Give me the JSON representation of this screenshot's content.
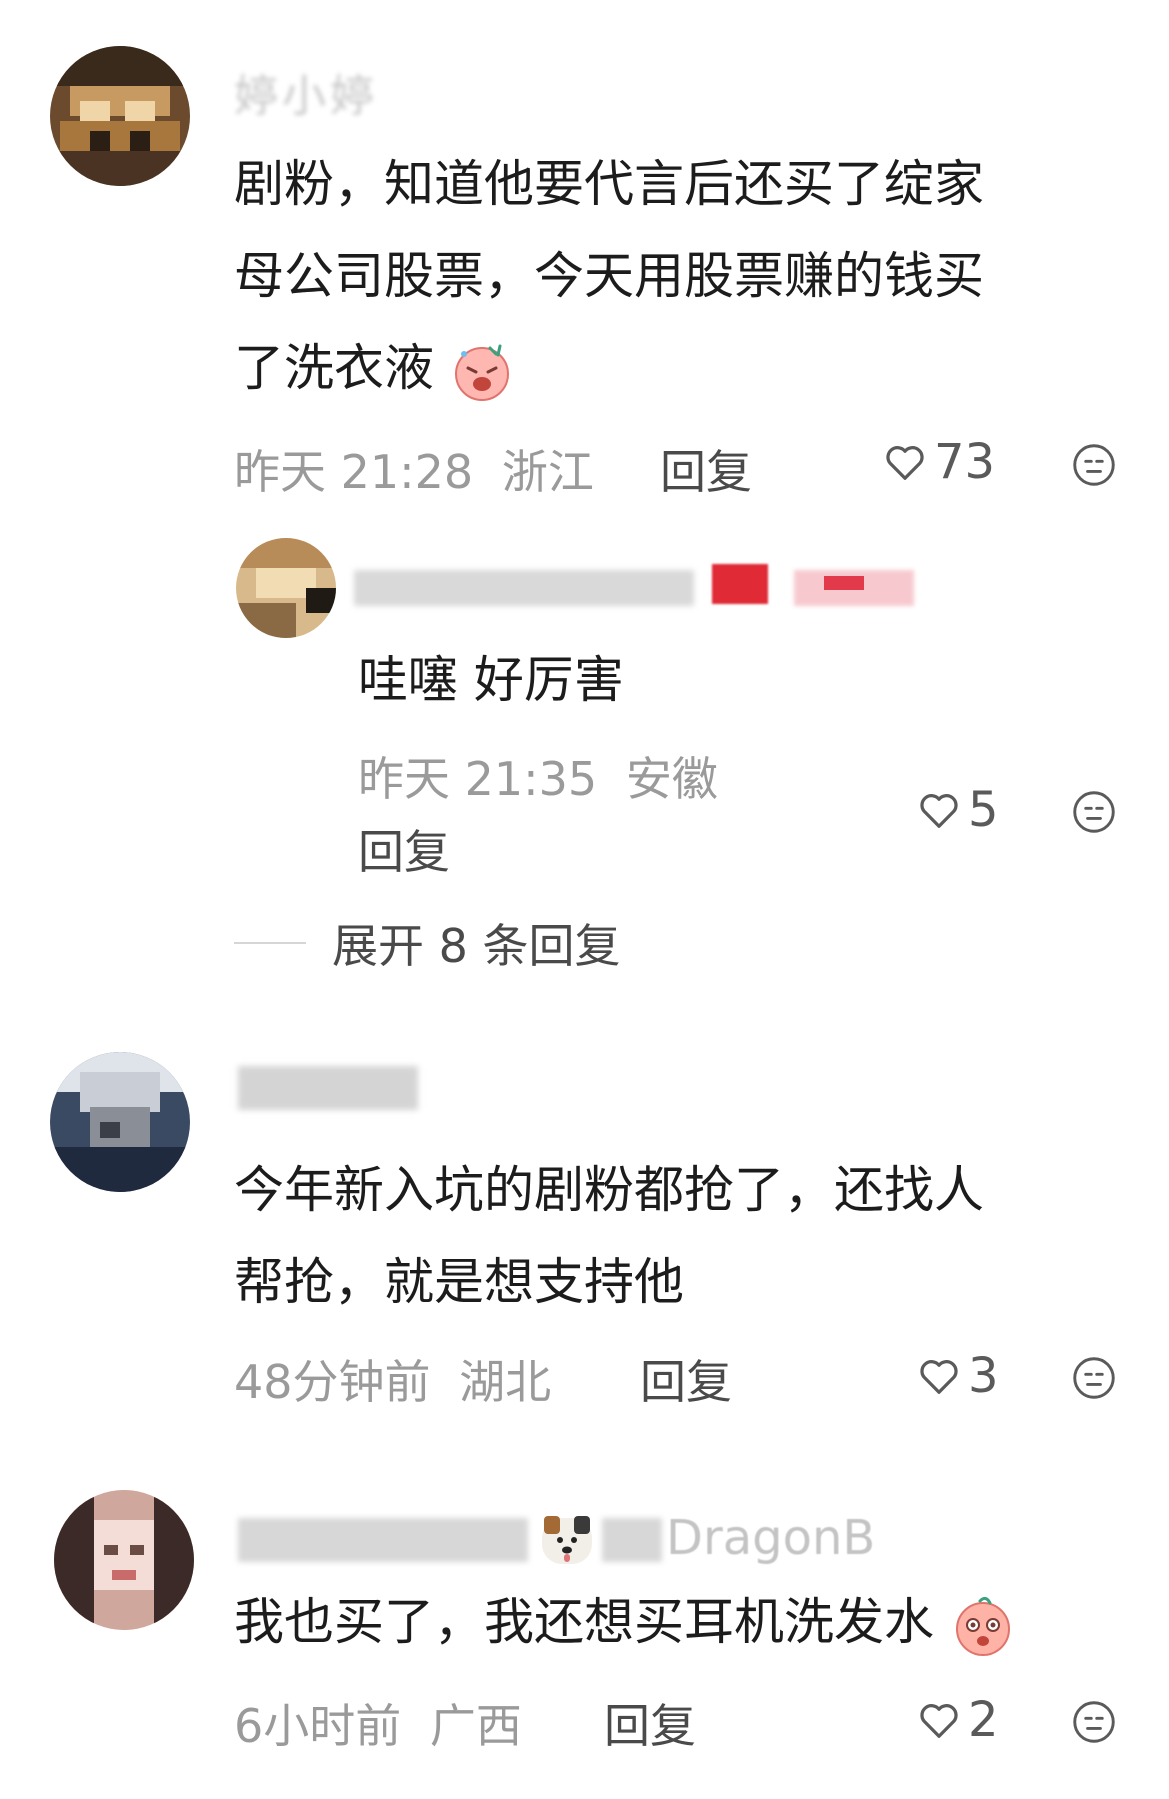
{
  "comments": [
    {
      "username": "婷小婷",
      "lines": [
        "剧粉，知道他要代言后还买了绽家",
        "母公司股票，今天用股票赚的钱买",
        "了洗衣液"
      ],
      "emoji": "crying-face-emoji",
      "time": "昨天 21:28",
      "location": "浙江",
      "reply_label": "回复",
      "likes": "73"
    },
    {
      "username": "",
      "lines": [
        "今年新入坑的剧粉都抢了，还找人",
        "帮抢，就是想支持他"
      ],
      "time": "48分钟前",
      "location": "湖北",
      "reply_label": "回复",
      "likes": "3"
    },
    {
      "username": "DragonB",
      "lines": [
        "我也买了，我还想买耳机洗发水"
      ],
      "emoji": "surprised-face-emoji",
      "time": "6小时前",
      "location": "广西",
      "reply_label": "回复",
      "likes": "2"
    }
  ],
  "sub_reply": {
    "text": "哇噻 好厉害",
    "time": "昨天 21:35",
    "location": "安徽",
    "reply_label": "回复",
    "likes": "5"
  },
  "expand_label": "展开 8 条回复",
  "icons": {
    "like": "heart-outline-icon",
    "dislike": "neutral-face-icon"
  }
}
